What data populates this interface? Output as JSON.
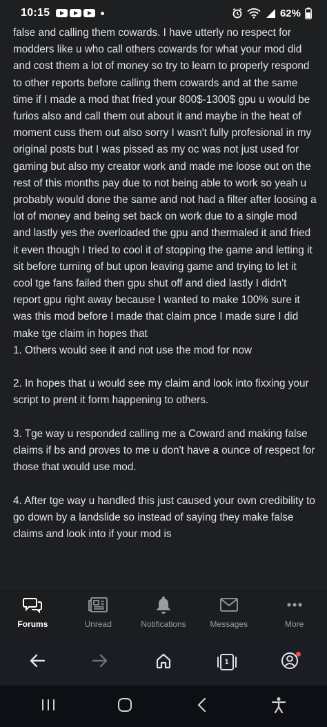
{
  "status_bar": {
    "time": "10:15",
    "battery": "62%",
    "notification_icons": [
      "youtube-icon",
      "youtube-icon",
      "youtube-icon"
    ]
  },
  "post": {
    "body": "false and calling them cowards. I have utterly no respect for modders like u who call others cowards for what your mod did and cost them a lot of money so try to learn to properly respond to other reports before calling them cowards and at the same time if I made a mod that fried your 800$-1300$ gpu u would be furios also and call them out about it and maybe in the heat of moment cuss them out also sorry I wasn't fully profesional in my original posts but I was pissed as my oc was not just used for gaming but also my creator work and made me loose out on the rest of this months pay due to not being able to work so yeah u probably would done the same and not had a filter after loosing a lot of money and being set back on work due to a single mod and lastly yes the overloaded the gpu and thermaled it and fried it even though I tried to cool it of stopping the game and letting it sit before turning of but upon leaving game and trying to let it cool tge fans failed then gpu shut off and died lastly I didn't report gpu right away because I wanted to make 100% sure it was this mod before I made that claim pnce I made sure I did make tge claim in hopes that\n1. Others would see it and not use the mod for now\n\n2. In hopes that u would see my claim and look into fixxing your script to prent it form happening to others.\n\n3. Tge way u responded calling me a Coward and making false claims if bs and proves to me u don't have a ounce of respect for those that would use mod.\n\n4. After tge way u handled this just caused your own credibility to go down by a landslide so instead of saying they make false claims and look into if your mod is"
  },
  "tab_bar": {
    "tabs": [
      {
        "label": "Forums",
        "icon": "forums-icon",
        "active": true
      },
      {
        "label": "Unread",
        "icon": "newspaper-icon",
        "active": false
      },
      {
        "label": "Notifications",
        "icon": "bell-icon",
        "active": false
      },
      {
        "label": "Messages",
        "icon": "envelope-icon",
        "active": false
      },
      {
        "label": "More",
        "icon": "more-dots-icon",
        "active": false
      }
    ]
  },
  "browser_bar": {
    "tab_count": "1",
    "icons": [
      "back-arrow-icon",
      "forward-arrow-icon",
      "home-icon",
      "tabs-icon",
      "account-icon"
    ]
  },
  "system_nav": {
    "icons": [
      "recent-apps-icon",
      "home-circle-icon",
      "back-chevron-icon",
      "accessibility-icon"
    ]
  },
  "colors": {
    "background": "#1e1f21",
    "text": "#e2e3e5",
    "muted": "#9a9ca1",
    "badge": "#ef4b46"
  }
}
